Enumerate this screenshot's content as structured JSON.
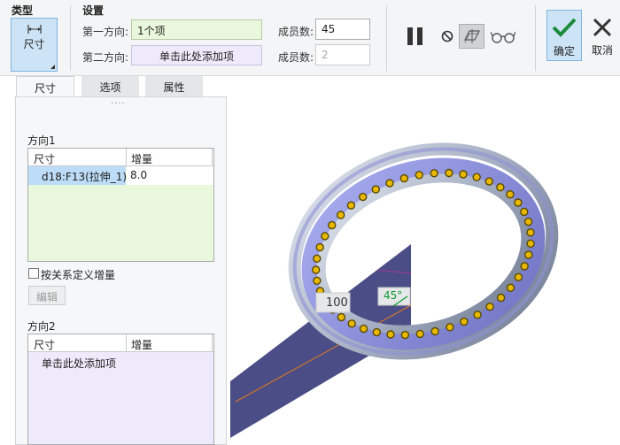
{
  "ribbon": {
    "type_title": "类型",
    "settings_title": "设置",
    "type_button_label": "尺寸",
    "dir1_label": "第一方向:",
    "dir1_value": "1个项",
    "dir2_label": "第二方向:",
    "dir2_value": "单击此处添加项",
    "members1_label": "成员数:",
    "members1_value": "45",
    "members2_label": "成员数:",
    "members2_value": "2",
    "ok_label": "确定",
    "cancel_label": "取消",
    "icons": [
      "pause-icon",
      "no-entry-icon",
      "preview-icon",
      "glasses-icon",
      "checkmark-icon",
      "close-icon"
    ]
  },
  "tabs": [
    "尺寸",
    "选项",
    "属性"
  ],
  "panel": {
    "direction1_title": "方向1",
    "direction1_table": {
      "columns": [
        "尺寸",
        "增量"
      ],
      "rows": [
        {
          "dimension": "d18:F13(拉伸_1)",
          "increment": "8.0"
        }
      ]
    },
    "relation_checkbox_label": "按关系定义增量",
    "relation_checked": false,
    "edit_button_label": "编辑",
    "direction2_title": "方向2",
    "direction2_table": {
      "columns": [
        "尺寸",
        "增量"
      ],
      "placeholder": "单击此处添加项"
    }
  },
  "viewport": {
    "dimension_tag": "100",
    "angle_tag": "45°",
    "pattern_member_count": 45
  },
  "colors": {
    "accent_blue": "#cde4f7",
    "selected_green": "#e9f7dc",
    "add_item_purple": "#efeafb",
    "ring_metal": "#aab3c8",
    "ring_inner": "#8d91d6",
    "pattern_dot": "#e8b800",
    "plane": "#4b4d86",
    "angle_green": "#0a9d2c"
  }
}
